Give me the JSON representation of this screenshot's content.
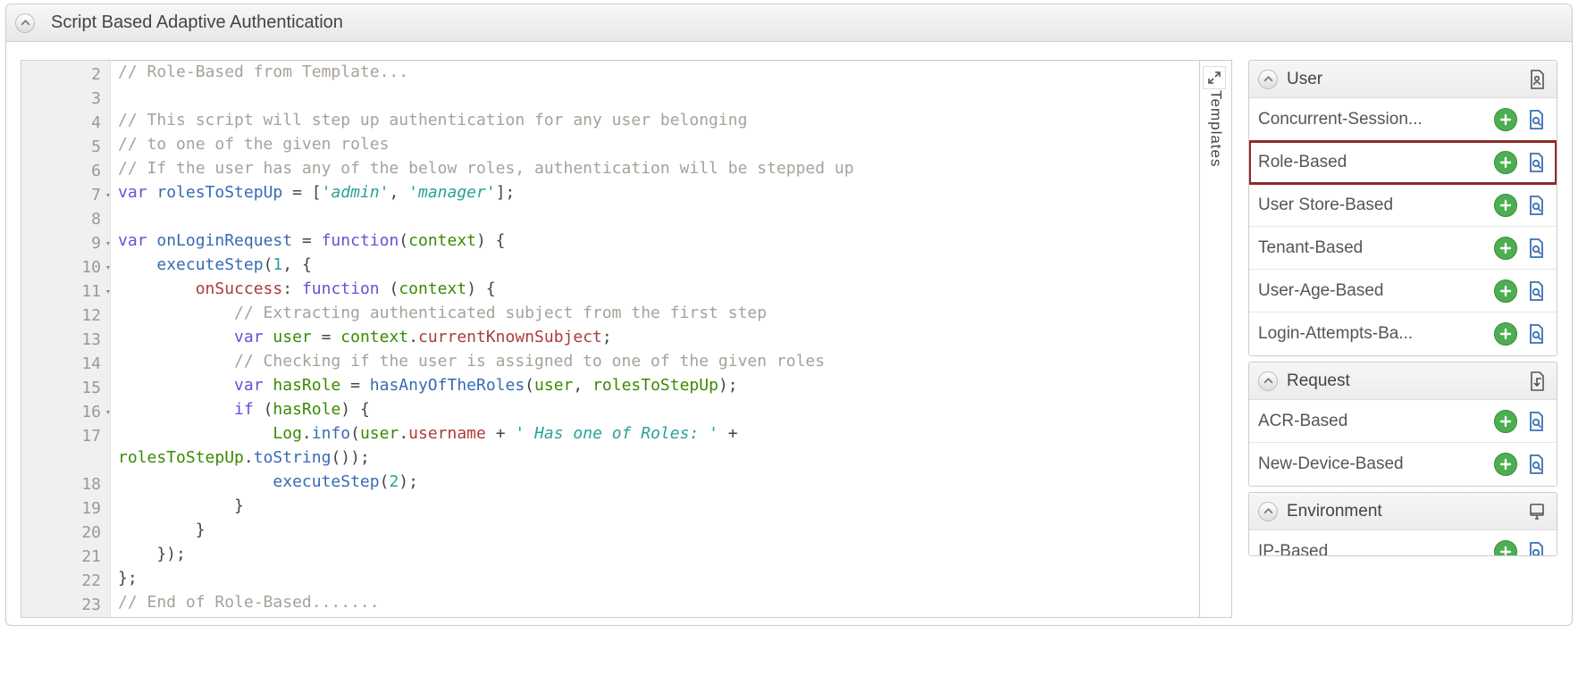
{
  "header": {
    "title": "Script Based Adaptive Authentication"
  },
  "editor": {
    "expand_icon": "expand-icon",
    "templates_tab_label": "Templates",
    "lines": [
      {
        "num": "2",
        "fold": false,
        "segs": [
          {
            "t": "// Role-Based from Template...",
            "c": "cm-comment"
          }
        ]
      },
      {
        "num": "3",
        "fold": false,
        "segs": []
      },
      {
        "num": "4",
        "fold": false,
        "segs": [
          {
            "t": "// This script will step up authentication for any user belonging",
            "c": "cm-comment"
          }
        ]
      },
      {
        "num": "5",
        "fold": false,
        "segs": [
          {
            "t": "// to one of the given roles",
            "c": "cm-comment"
          }
        ]
      },
      {
        "num": "6",
        "fold": false,
        "segs": [
          {
            "t": "// If the user has any of the below roles, authentication will be stepped up",
            "c": "cm-comment"
          }
        ]
      },
      {
        "num": "7",
        "fold": true,
        "segs": [
          {
            "t": "var",
            "c": "cm-keyword"
          },
          {
            "t": " "
          },
          {
            "t": "rolesToStepUp",
            "c": "cm-def"
          },
          {
            "t": " = ["
          },
          {
            "t": "'admin'",
            "c": "cm-string"
          },
          {
            "t": ", "
          },
          {
            "t": "'manager'",
            "c": "cm-string"
          },
          {
            "t": "];"
          }
        ]
      },
      {
        "num": "8",
        "fold": false,
        "segs": []
      },
      {
        "num": "9",
        "fold": true,
        "segs": [
          {
            "t": "var",
            "c": "cm-keyword"
          },
          {
            "t": " "
          },
          {
            "t": "onLoginRequest",
            "c": "cm-def"
          },
          {
            "t": " = "
          },
          {
            "t": "function",
            "c": "cm-keyword"
          },
          {
            "t": "("
          },
          {
            "t": "context",
            "c": "cm-id"
          },
          {
            "t": ") {"
          }
        ]
      },
      {
        "num": "10",
        "fold": true,
        "segs": [
          {
            "t": "    "
          },
          {
            "t": "executeStep",
            "c": "cm-func"
          },
          {
            "t": "("
          },
          {
            "t": "1",
            "c": "cm-number"
          },
          {
            "t": ", {"
          }
        ]
      },
      {
        "num": "11",
        "fold": true,
        "segs": [
          {
            "t": "        "
          },
          {
            "t": "onSuccess",
            "c": "cm-prop"
          },
          {
            "t": ": "
          },
          {
            "t": "function",
            "c": "cm-keyword"
          },
          {
            "t": " ("
          },
          {
            "t": "context",
            "c": "cm-id"
          },
          {
            "t": ") {"
          }
        ]
      },
      {
        "num": "12",
        "fold": false,
        "segs": [
          {
            "t": "            "
          },
          {
            "t": "// Extracting authenticated subject from the first step",
            "c": "cm-comment"
          }
        ]
      },
      {
        "num": "13",
        "fold": false,
        "segs": [
          {
            "t": "            "
          },
          {
            "t": "var",
            "c": "cm-keyword"
          },
          {
            "t": " "
          },
          {
            "t": "user",
            "c": "cm-id"
          },
          {
            "t": " = "
          },
          {
            "t": "context",
            "c": "cm-id"
          },
          {
            "t": "."
          },
          {
            "t": "currentKnownSubject",
            "c": "cm-prop"
          },
          {
            "t": ";"
          }
        ]
      },
      {
        "num": "14",
        "fold": false,
        "segs": [
          {
            "t": "            "
          },
          {
            "t": "// Checking if the user is assigned to one of the given roles",
            "c": "cm-comment"
          }
        ]
      },
      {
        "num": "15",
        "fold": false,
        "segs": [
          {
            "t": "            "
          },
          {
            "t": "var",
            "c": "cm-keyword"
          },
          {
            "t": " "
          },
          {
            "t": "hasRole",
            "c": "cm-id"
          },
          {
            "t": " = "
          },
          {
            "t": "hasAnyOfTheRoles",
            "c": "cm-func"
          },
          {
            "t": "("
          },
          {
            "t": "user",
            "c": "cm-id"
          },
          {
            "t": ", "
          },
          {
            "t": "rolesToStepUp",
            "c": "cm-id"
          },
          {
            "t": ");"
          }
        ]
      },
      {
        "num": "16",
        "fold": true,
        "segs": [
          {
            "t": "            "
          },
          {
            "t": "if",
            "c": "cm-keyword"
          },
          {
            "t": " ("
          },
          {
            "t": "hasRole",
            "c": "cm-id"
          },
          {
            "t": ") {"
          }
        ]
      },
      {
        "num": "17",
        "fold": false,
        "segs": [
          {
            "t": "                "
          },
          {
            "t": "Log",
            "c": "cm-id"
          },
          {
            "t": "."
          },
          {
            "t": "info",
            "c": "cm-func"
          },
          {
            "t": "("
          },
          {
            "t": "user",
            "c": "cm-id"
          },
          {
            "t": "."
          },
          {
            "t": "username",
            "c": "cm-prop"
          },
          {
            "t": " + "
          },
          {
            "t": "' Has one of Roles: '",
            "c": "cm-string"
          },
          {
            "t": " + "
          }
        ]
      },
      {
        "num": "",
        "fold": false,
        "segs": [
          {
            "t": "rolesToStepUp",
            "c": "cm-id"
          },
          {
            "t": "."
          },
          {
            "t": "toString",
            "c": "cm-func"
          },
          {
            "t": "());"
          }
        ]
      },
      {
        "num": "18",
        "fold": false,
        "segs": [
          {
            "t": "                "
          },
          {
            "t": "executeStep",
            "c": "cm-func"
          },
          {
            "t": "("
          },
          {
            "t": "2",
            "c": "cm-number"
          },
          {
            "t": ");"
          }
        ]
      },
      {
        "num": "19",
        "fold": false,
        "segs": [
          {
            "t": "            }"
          }
        ]
      },
      {
        "num": "20",
        "fold": false,
        "segs": [
          {
            "t": "        }"
          }
        ]
      },
      {
        "num": "21",
        "fold": false,
        "segs": [
          {
            "t": "    });"
          }
        ]
      },
      {
        "num": "22",
        "fold": false,
        "segs": [
          {
            "t": "};"
          }
        ]
      },
      {
        "num": "23",
        "fold": false,
        "segs": [
          {
            "t": "// End of Role-Based.......",
            "c": "cm-comment"
          }
        ]
      }
    ]
  },
  "templates": {
    "categories": [
      {
        "name": "User",
        "icon": "user-doc-icon",
        "items": [
          {
            "label": "Concurrent-Session...",
            "highlight": false
          },
          {
            "label": "Role-Based",
            "highlight": true
          },
          {
            "label": "User Store-Based",
            "highlight": false
          },
          {
            "label": "Tenant-Based",
            "highlight": false
          },
          {
            "label": "User-Age-Based",
            "highlight": false
          },
          {
            "label": "Login-Attempts-Ba...",
            "highlight": false
          }
        ]
      },
      {
        "name": "Request",
        "icon": "request-doc-icon",
        "items": [
          {
            "label": "ACR-Based",
            "highlight": false
          },
          {
            "label": "New-Device-Based",
            "highlight": false
          }
        ]
      },
      {
        "name": "Environment",
        "icon": "environment-doc-icon",
        "items": [
          {
            "label": "IP-Based",
            "highlight": false
          }
        ],
        "cut": true
      }
    ]
  }
}
